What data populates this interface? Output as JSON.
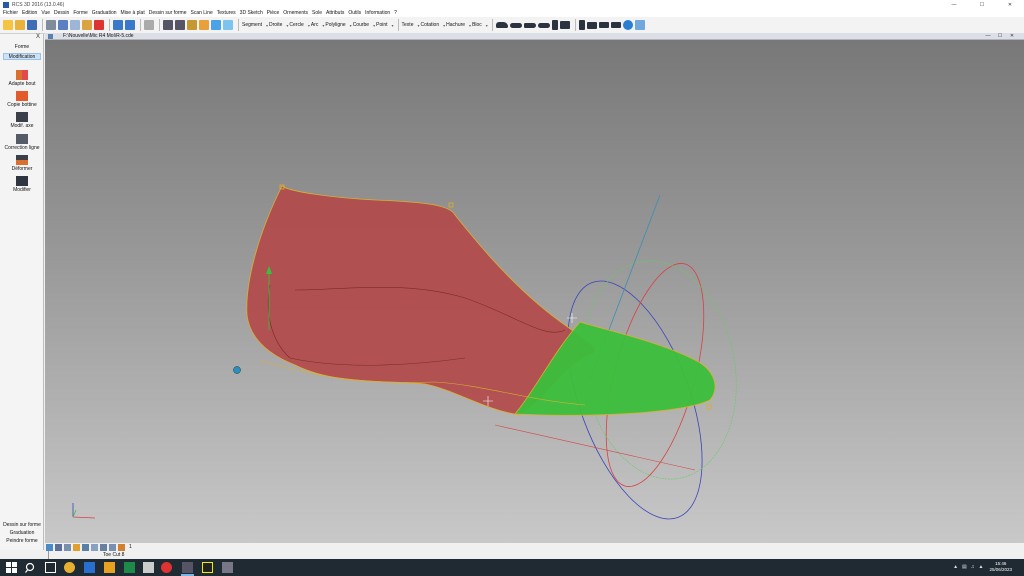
{
  "window": {
    "title": "RCS 3D 2016 (13.0.46)",
    "minimize": "—",
    "maximize": "☐",
    "close": "✕"
  },
  "menu": [
    "Fichier",
    "Edition",
    "Vue",
    "Dessin",
    "Forme",
    "Graduation",
    "Mise à plat",
    "Dessin sur forme",
    "Scan Line",
    "Textures",
    "3D Sketch",
    "Pièce",
    "Ornements",
    "Sole",
    "Attributs",
    "Outils",
    "Information",
    "?"
  ],
  "toolbar": {
    "draw_tools": [
      "Segment",
      "Droite",
      "Cercle",
      "Arc",
      "Polyligne",
      "Courbe",
      "Point"
    ],
    "annot_tools": [
      "Texte",
      "Cotation",
      "Hachure",
      "Bloc"
    ]
  },
  "left_panel": {
    "close": "X",
    "tabs": [
      "Forme",
      "Modification"
    ],
    "active_tab": "Modification",
    "tools": [
      "Adapte bout",
      "Copie bottine",
      "Modif. axe",
      "Correction ligne",
      "Déformer",
      "Modifier"
    ],
    "bottom_tabs": [
      "Dessin sur forme",
      "Graduation",
      "Peindre forme"
    ]
  },
  "document": {
    "path": "F:\\Nouvelle\\Mic R4 Moi\\R-5.cde",
    "min": "—",
    "max": "☐",
    "close": "✕"
  },
  "bottom_toolbar": {
    "layer_number": "1"
  },
  "status": {
    "text": "Toe Cut 8"
  },
  "taskbar": {
    "time": "15:46",
    "date": "25/06/2023"
  },
  "colors": {
    "shoe_body": "#b34a4a",
    "toe_cap": "#3bbf3b",
    "viewport_top": "#787878",
    "viewport_bottom": "#c8c8c8"
  }
}
